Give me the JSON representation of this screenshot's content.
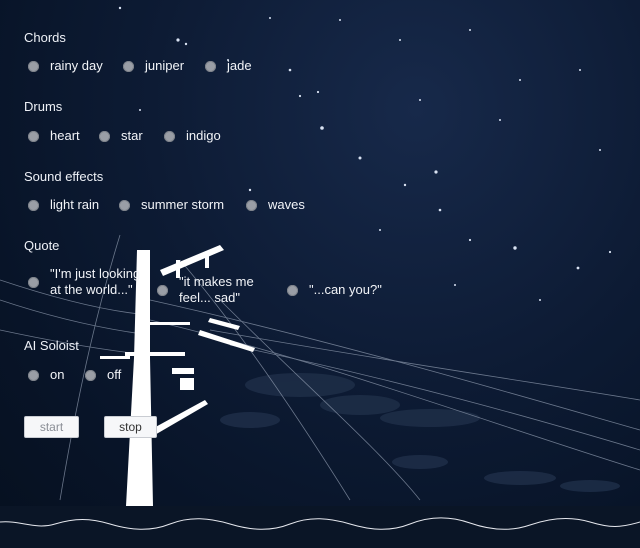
{
  "sections": {
    "chords": {
      "label": "Chords",
      "options": [
        "rainy day",
        "juniper",
        "jade"
      ]
    },
    "drums": {
      "label": "Drums",
      "options": [
        "heart",
        "star",
        "indigo"
      ]
    },
    "sound_effects": {
      "label": "Sound effects",
      "options": [
        "light rain",
        "summer storm",
        "waves"
      ]
    },
    "quote": {
      "label": "Quote",
      "options": [
        "\"I'm just looking at the world...\"",
        "\"it makes me feel... sad\"",
        "\"...can you?\""
      ]
    },
    "ai_soloist": {
      "label": "AI Soloist",
      "options": [
        "on",
        "off"
      ]
    }
  },
  "buttons": {
    "start": "start",
    "stop": "stop"
  },
  "colors": {
    "sky_top": "#17294a",
    "sky_bottom": "#06101f",
    "radio_fill": "#9a9ea6",
    "wave": "#e6e8ee"
  }
}
